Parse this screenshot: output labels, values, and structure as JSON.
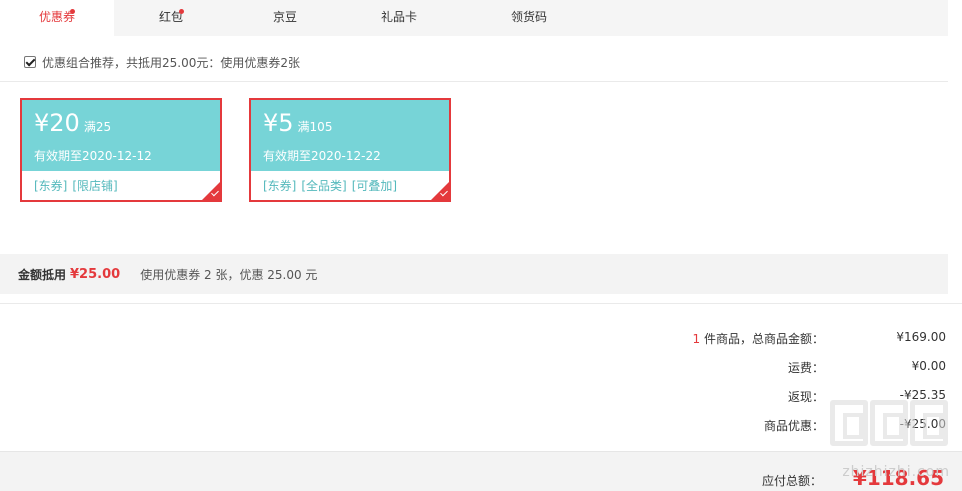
{
  "tabs": [
    {
      "label": "优惠券",
      "active": true,
      "has_dot": true
    },
    {
      "label": "红包",
      "active": false,
      "has_dot": true
    },
    {
      "label": "京豆",
      "active": false,
      "has_dot": false
    },
    {
      "label": "礼品卡",
      "active": false,
      "has_dot": false
    },
    {
      "label": "领货码",
      "active": false,
      "has_dot": false
    }
  ],
  "combo": {
    "checked": true,
    "text": "优惠组合推荐，共抵用25.00元：使用优惠券2张"
  },
  "coupons": [
    {
      "amount": "¥20",
      "condition": "满25",
      "expiry": "有效期至2020-12-12",
      "tags": [
        "[东券]",
        "[限店铺]"
      ],
      "selected": true
    },
    {
      "amount": "¥5",
      "condition": "满105",
      "expiry": "有效期至2020-12-22",
      "tags": [
        "[东券]",
        "[全品类]",
        "[可叠加]"
      ],
      "selected": true
    }
  ],
  "summary": {
    "label": "金额抵用",
    "amount": "¥25.00",
    "detail": "使用优惠券 2 张，优惠 25.00 元"
  },
  "totals": {
    "item_count": "1",
    "goods_label": " 件商品，总商品金额：",
    "goods_value": "¥169.00",
    "shipping_label": "运费：",
    "shipping_value": "¥0.00",
    "cashback_label": "返现：",
    "cashback_value": "-¥25.35",
    "discount_label": "商品优惠：",
    "discount_value": "-¥25.00",
    "payable_label": "应付总额：",
    "payable_value": "¥118.65"
  },
  "watermark": {
    "text": "zhizhizhi.com"
  },
  "colors": {
    "accent": "#e4393c",
    "coupon_bg": "#77d4d7",
    "tag": "#55b9bc"
  }
}
